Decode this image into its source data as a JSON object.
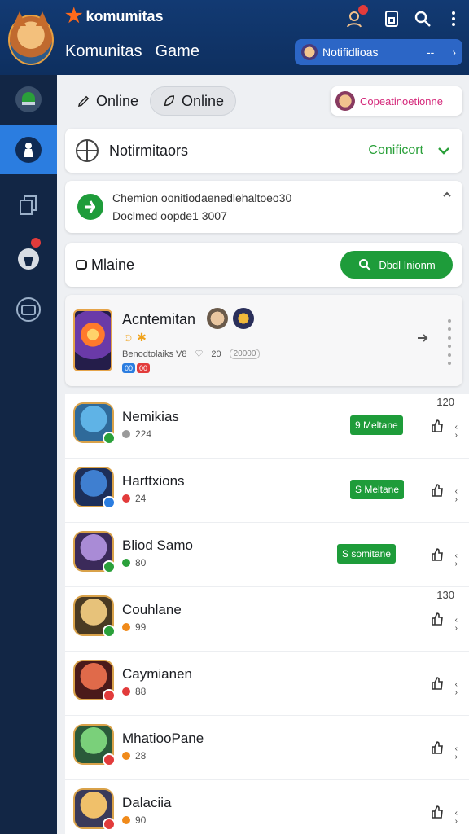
{
  "header": {
    "brand": "komumitas",
    "subtitle_left": "Komunitas",
    "subtitle_right": "Game",
    "notification_pill": {
      "label": "Notifidlioas",
      "trailing": "--"
    }
  },
  "top_row": {
    "online_1": "Online",
    "online_2": "Online",
    "profile_chip": "Copeatinoetionne"
  },
  "notification_card": {
    "title": "Notirmitaors",
    "action": "Conificort"
  },
  "info_card": {
    "line1": "Chemion oonitiodaenedlehaltoeo30",
    "line2": "Doclmed oopde1 3007"
  },
  "search_card": {
    "label": "Mlaine",
    "button": "Dbdl Inionm"
  },
  "featured": {
    "title": "Acntemitan",
    "subtitle": "Benodtolaiks V8",
    "count": "20",
    "pill": "20000",
    "tags": [
      {
        "label": "00",
        "color": "#2b7de0"
      },
      {
        "label": "00",
        "color": "#e23b3b"
      }
    ]
  },
  "friends": [
    {
      "name": "Nemikias",
      "sub": "224",
      "button": "9 Meltane",
      "count": "120",
      "status_color": "#2aa03a",
      "dot_color": "#9a9a9a",
      "avatar": [
        "#5fb3e6",
        "#2f6a9a"
      ]
    },
    {
      "name": "Harttxions",
      "sub": "24",
      "button": "S Meltane",
      "count": "",
      "status_color": "#2b7de0",
      "dot_color": "#e23b3b",
      "avatar": [
        "#3f7fd0",
        "#1d2f5a"
      ]
    },
    {
      "name": "Bliod Samo",
      "sub": "80",
      "button": "S somitane",
      "count": "",
      "status_color": "#2aa03a",
      "dot_color": "#2aa03a",
      "avatar": [
        "#a98bd6",
        "#3b2a5a"
      ]
    },
    {
      "name": "Couhlane",
      "sub": "99",
      "button": "",
      "count": "130",
      "status_color": "#2aa03a",
      "dot_color": "#f08a1a",
      "avatar": [
        "#e7c27a",
        "#4a3a22"
      ]
    },
    {
      "name": "Caymianen",
      "sub": "88",
      "button": "",
      "count": "",
      "status_color": "#e23b3b",
      "dot_color": "#e23b3b",
      "avatar": [
        "#e06a4a",
        "#4a1a1a"
      ]
    },
    {
      "name": "MhatiooPane",
      "sub": "28",
      "button": "",
      "count": "",
      "status_color": "#e23b3b",
      "dot_color": "#f08a1a",
      "avatar": [
        "#7ad07a",
        "#2a5a3a"
      ]
    },
    {
      "name": "Dalaciia",
      "sub": "90",
      "button": "",
      "count": "",
      "status_color": "#e23b3b",
      "dot_color": "#f08a1a",
      "avatar": [
        "#f0c06a",
        "#3a3a5a"
      ]
    }
  ],
  "colors": {
    "header": "#123a73",
    "sidebar": "#122645",
    "accent": "#2b7de0",
    "green": "#1e9c3a"
  },
  "icons": [
    "user-plus-icon",
    "tablet-icon",
    "search-icon",
    "more-vertical-icon",
    "chat-icon",
    "profile-icon",
    "copy-icon",
    "notification-icon",
    "gamepad-icon"
  ]
}
